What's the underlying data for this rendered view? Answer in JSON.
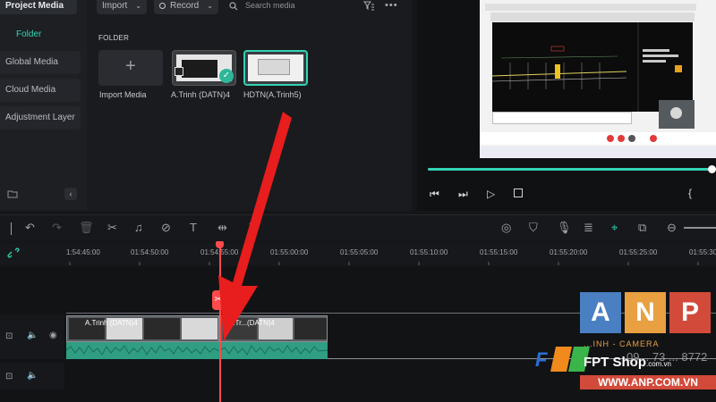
{
  "sidebar": {
    "header": "Project Media",
    "items": [
      {
        "label": "Folder"
      },
      {
        "label": "Global Media"
      },
      {
        "label": "Cloud Media"
      },
      {
        "label": "Adjustment Layer"
      }
    ]
  },
  "media_toolbar": {
    "import_label": "Import",
    "record_label": "Record",
    "search_placeholder": "Search media"
  },
  "media": {
    "folder_label": "FOLDER",
    "items": [
      {
        "label": "Import Media"
      },
      {
        "label": "A.Trinh  (DATN)4"
      },
      {
        "label": "HDTN(A.Trinh5)"
      }
    ]
  },
  "ruler": {
    "ticks": [
      "1:54:45:00",
      "01:54:50:00",
      "01:54:55:00",
      "01:55:00:00",
      "01:55:05:00",
      "01:55:10:00",
      "01:55:15:00",
      "01:55:20:00",
      "01:55:25:00",
      "01:55:30"
    ]
  },
  "clips": {
    "left_label": "A.Trinh  (DATN)4",
    "right_label": "A.Tr...(DATN)4"
  },
  "watermark": {
    "letters": [
      "A",
      "N",
      "P"
    ],
    "phone_line": "09... 73 ... 8772",
    "brand": "FPT Shop",
    "brand_suffix": ".com.vn",
    "tagline": "...INH - CAMERA",
    "site": "WWW.ANP.COM.VN"
  },
  "colors": {
    "accent": "#31d3b4",
    "playhead": "#ff4b4b",
    "arrow": "#e81d1d",
    "audio_wave": "#2f9e83"
  }
}
